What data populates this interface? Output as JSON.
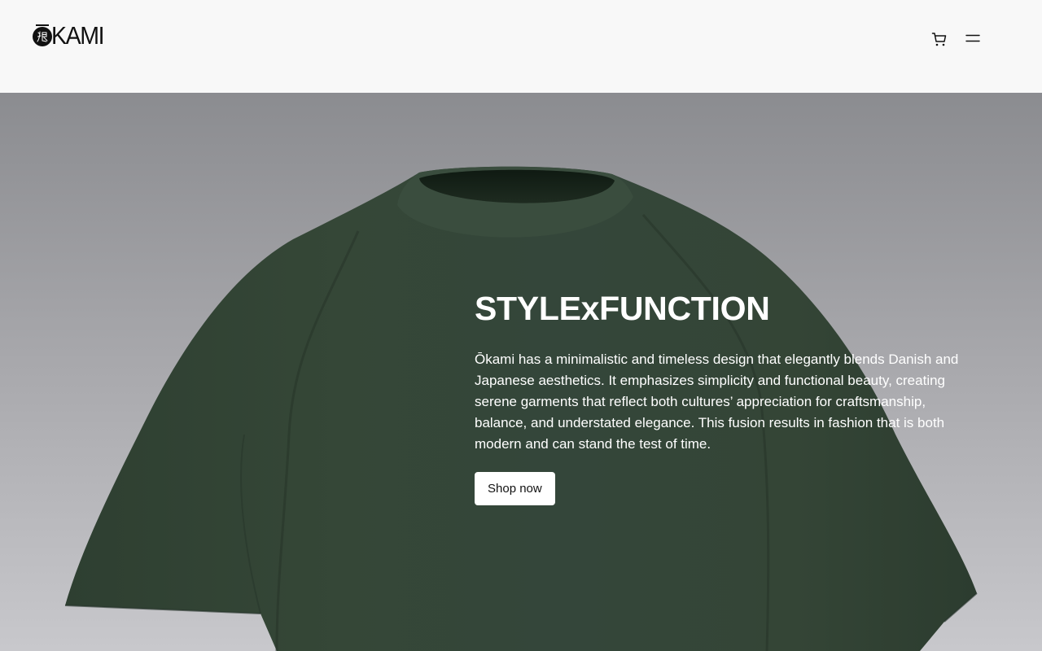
{
  "header": {
    "brand": "ŌKAMI",
    "logo_text": "KAMI",
    "icons": [
      "cart-icon",
      "menu-icon"
    ]
  },
  "hero": {
    "title": "STYLExFUNCTION",
    "description": "Ōkami has a minimalistic and timeless design that elegantly blends Danish and Japanese aesthetics. It emphasizes simplicity and functional beauty, creating serene garments that reflect both cultures’ appreciation for craftsmanship, balance, and understated elegance. This fusion results in fashion that is both modern and can stand the test of time.",
    "cta_label": "Shop now",
    "image": "green-t-shirt"
  },
  "colors": {
    "shirt": "#334536",
    "header_bg": "#f8f8f8",
    "button_bg": "#ffffff",
    "text_light": "#ffffff"
  }
}
